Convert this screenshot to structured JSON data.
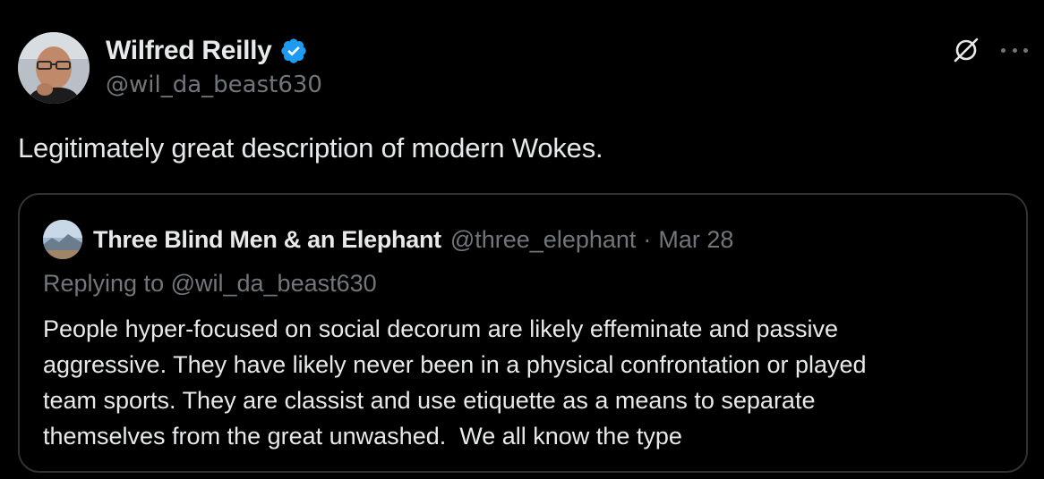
{
  "tweet": {
    "author": {
      "name": "Wilfred Reilly",
      "handle": "@wil_da_beast630",
      "verified": true,
      "verified_color": "#1d9bf0"
    },
    "text": "Legitimately great description of modern Wokes.",
    "actions": {
      "grok_icon": "grok-icon",
      "more_icon": "more-icon"
    },
    "quoted": {
      "author": {
        "name": "Three Blind Men & an Elephant",
        "handle": "@three_elephant"
      },
      "separator": "·",
      "date": "Mar 28",
      "replying_to": "Replying to @wil_da_beast630",
      "body_lines": [
        "People hyper-focused on social decorum are likely effeminate and passive",
        "aggressive. They have likely never been in a physical confrontation or played",
        "team sports. They are classist and use etiquette as a means to separate",
        "themselves from the great unwashed.  We all know the type"
      ]
    }
  },
  "colors": {
    "background": "#000000",
    "primary_text": "#e7e9ea",
    "secondary_text": "#71767b",
    "border": "#2f3336"
  }
}
